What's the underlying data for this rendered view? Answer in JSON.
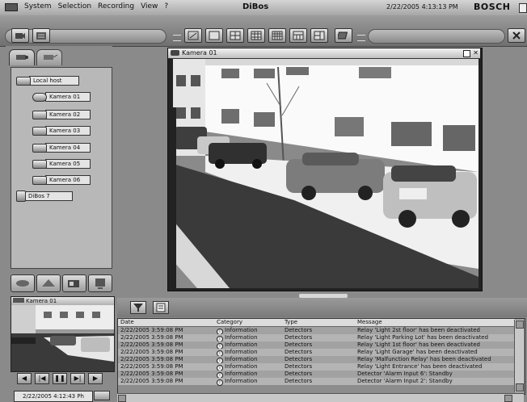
{
  "menu": [
    "System",
    "Selection",
    "Recording",
    "View",
    "?"
  ],
  "app_title": "DiBos",
  "datetime": "2/22/2005 4:13:13 PM",
  "brand": "BOSCH",
  "tree": {
    "root": "Local host",
    "cameras": [
      "Kamera 01",
      "Kamera 02",
      "Kamera 03",
      "Kamera 04",
      "Kamera 05",
      "Kamera 06"
    ],
    "second_root": "DiBos 7"
  },
  "main_camera": {
    "title": "Kamera 01"
  },
  "mini_camera": {
    "title": "Kamera 01",
    "time": "2/22/2005  4:12:43 Ph"
  },
  "log": {
    "columns": [
      "Date",
      "Category",
      "Type",
      "Message"
    ],
    "rows": [
      [
        "2/22/2005 3:59:08 PM",
        "Information",
        "Detectors",
        "Relay 'Light 2st floor' has been deactivated"
      ],
      [
        "2/22/2005 3:59:08 PM",
        "Information",
        "Detectors",
        "Relay 'Light Parking Lot' has been deactivated"
      ],
      [
        "2/22/2005 3:59:08 PM",
        "Information",
        "Detectors",
        "Relay 'Light 1st floor' has been deactivated"
      ],
      [
        "2/22/2005 3:59:08 PM",
        "Information",
        "Detectors",
        "Relay 'Light Garage' has been deactivated"
      ],
      [
        "2/22/2005 3:59:08 PM",
        "Information",
        "Detectors",
        "Relay 'Malfunction Relay' has been deactivated"
      ],
      [
        "2/22/2005 3:59:08 PM",
        "Information",
        "Detectors",
        "Relay 'Light Entrance' has been deactivated"
      ],
      [
        "2/22/2005 3:59:08 PM",
        "Information",
        "Detectors",
        "Detector 'Alarm Input 6': Standby"
      ],
      [
        "2/22/2005 3:59:08 PM",
        "Information",
        "Detectors",
        "Detector 'Alarm Input 2': Standby"
      ]
    ]
  },
  "colors": {
    "chrome": "#8a8a8a",
    "panel": "#b8b8b8",
    "row_alt": "#b4b4b4"
  }
}
